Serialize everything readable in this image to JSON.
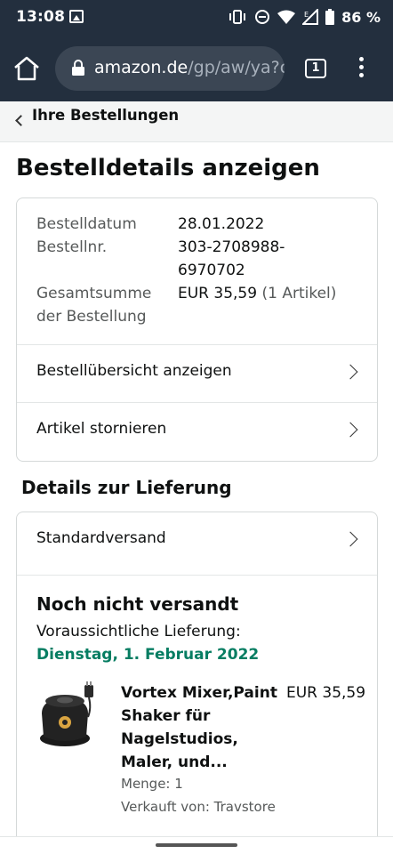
{
  "status_bar": {
    "time": "13:08",
    "battery": "86 %",
    "signal_marker": "E",
    "icons": [
      "gallery-icon",
      "vibrate-icon",
      "do-not-disturb-icon",
      "wifi-icon",
      "signal-icon",
      "battery-icon"
    ]
  },
  "browser": {
    "url_domain": "amazon.de",
    "url_path": "/gp/aw/ya?c",
    "tab_count": "1"
  },
  "back_nav": {
    "label": "Ihre Bestellungen"
  },
  "page": {
    "title": "Bestelldetails anzeigen"
  },
  "order": {
    "date_label": "Bestelldatum",
    "date_value": "28.01.2022",
    "number_label": "Bestellnr.",
    "number_value": "303-2708988-\n6970702",
    "total_label": "Gesamtsumme der Bestellung",
    "total_value": "EUR 35,59",
    "total_suffix": " (1 Artikel)",
    "link_overview": "Bestellübersicht anzeigen",
    "link_cancel": "Artikel stornieren"
  },
  "delivery": {
    "heading": "Details zur Lieferung",
    "shipping_method": "Standardversand",
    "status": "Noch nicht versandt",
    "eta_label": "Voraussichtliche Lieferung:",
    "eta_date": "Dienstag, 1. Februar 2022",
    "eta_color": "#067d62"
  },
  "item": {
    "title": "Vortex Mixer,Paint Shaker für Nagelstudios, Maler, und...",
    "price": "EUR 35,59",
    "quantity": "Menge: 1",
    "seller": "Verkauft von: Travstore"
  },
  "colors": {
    "header_bg": "#232f3e",
    "url_pill_bg": "#3b4654"
  }
}
